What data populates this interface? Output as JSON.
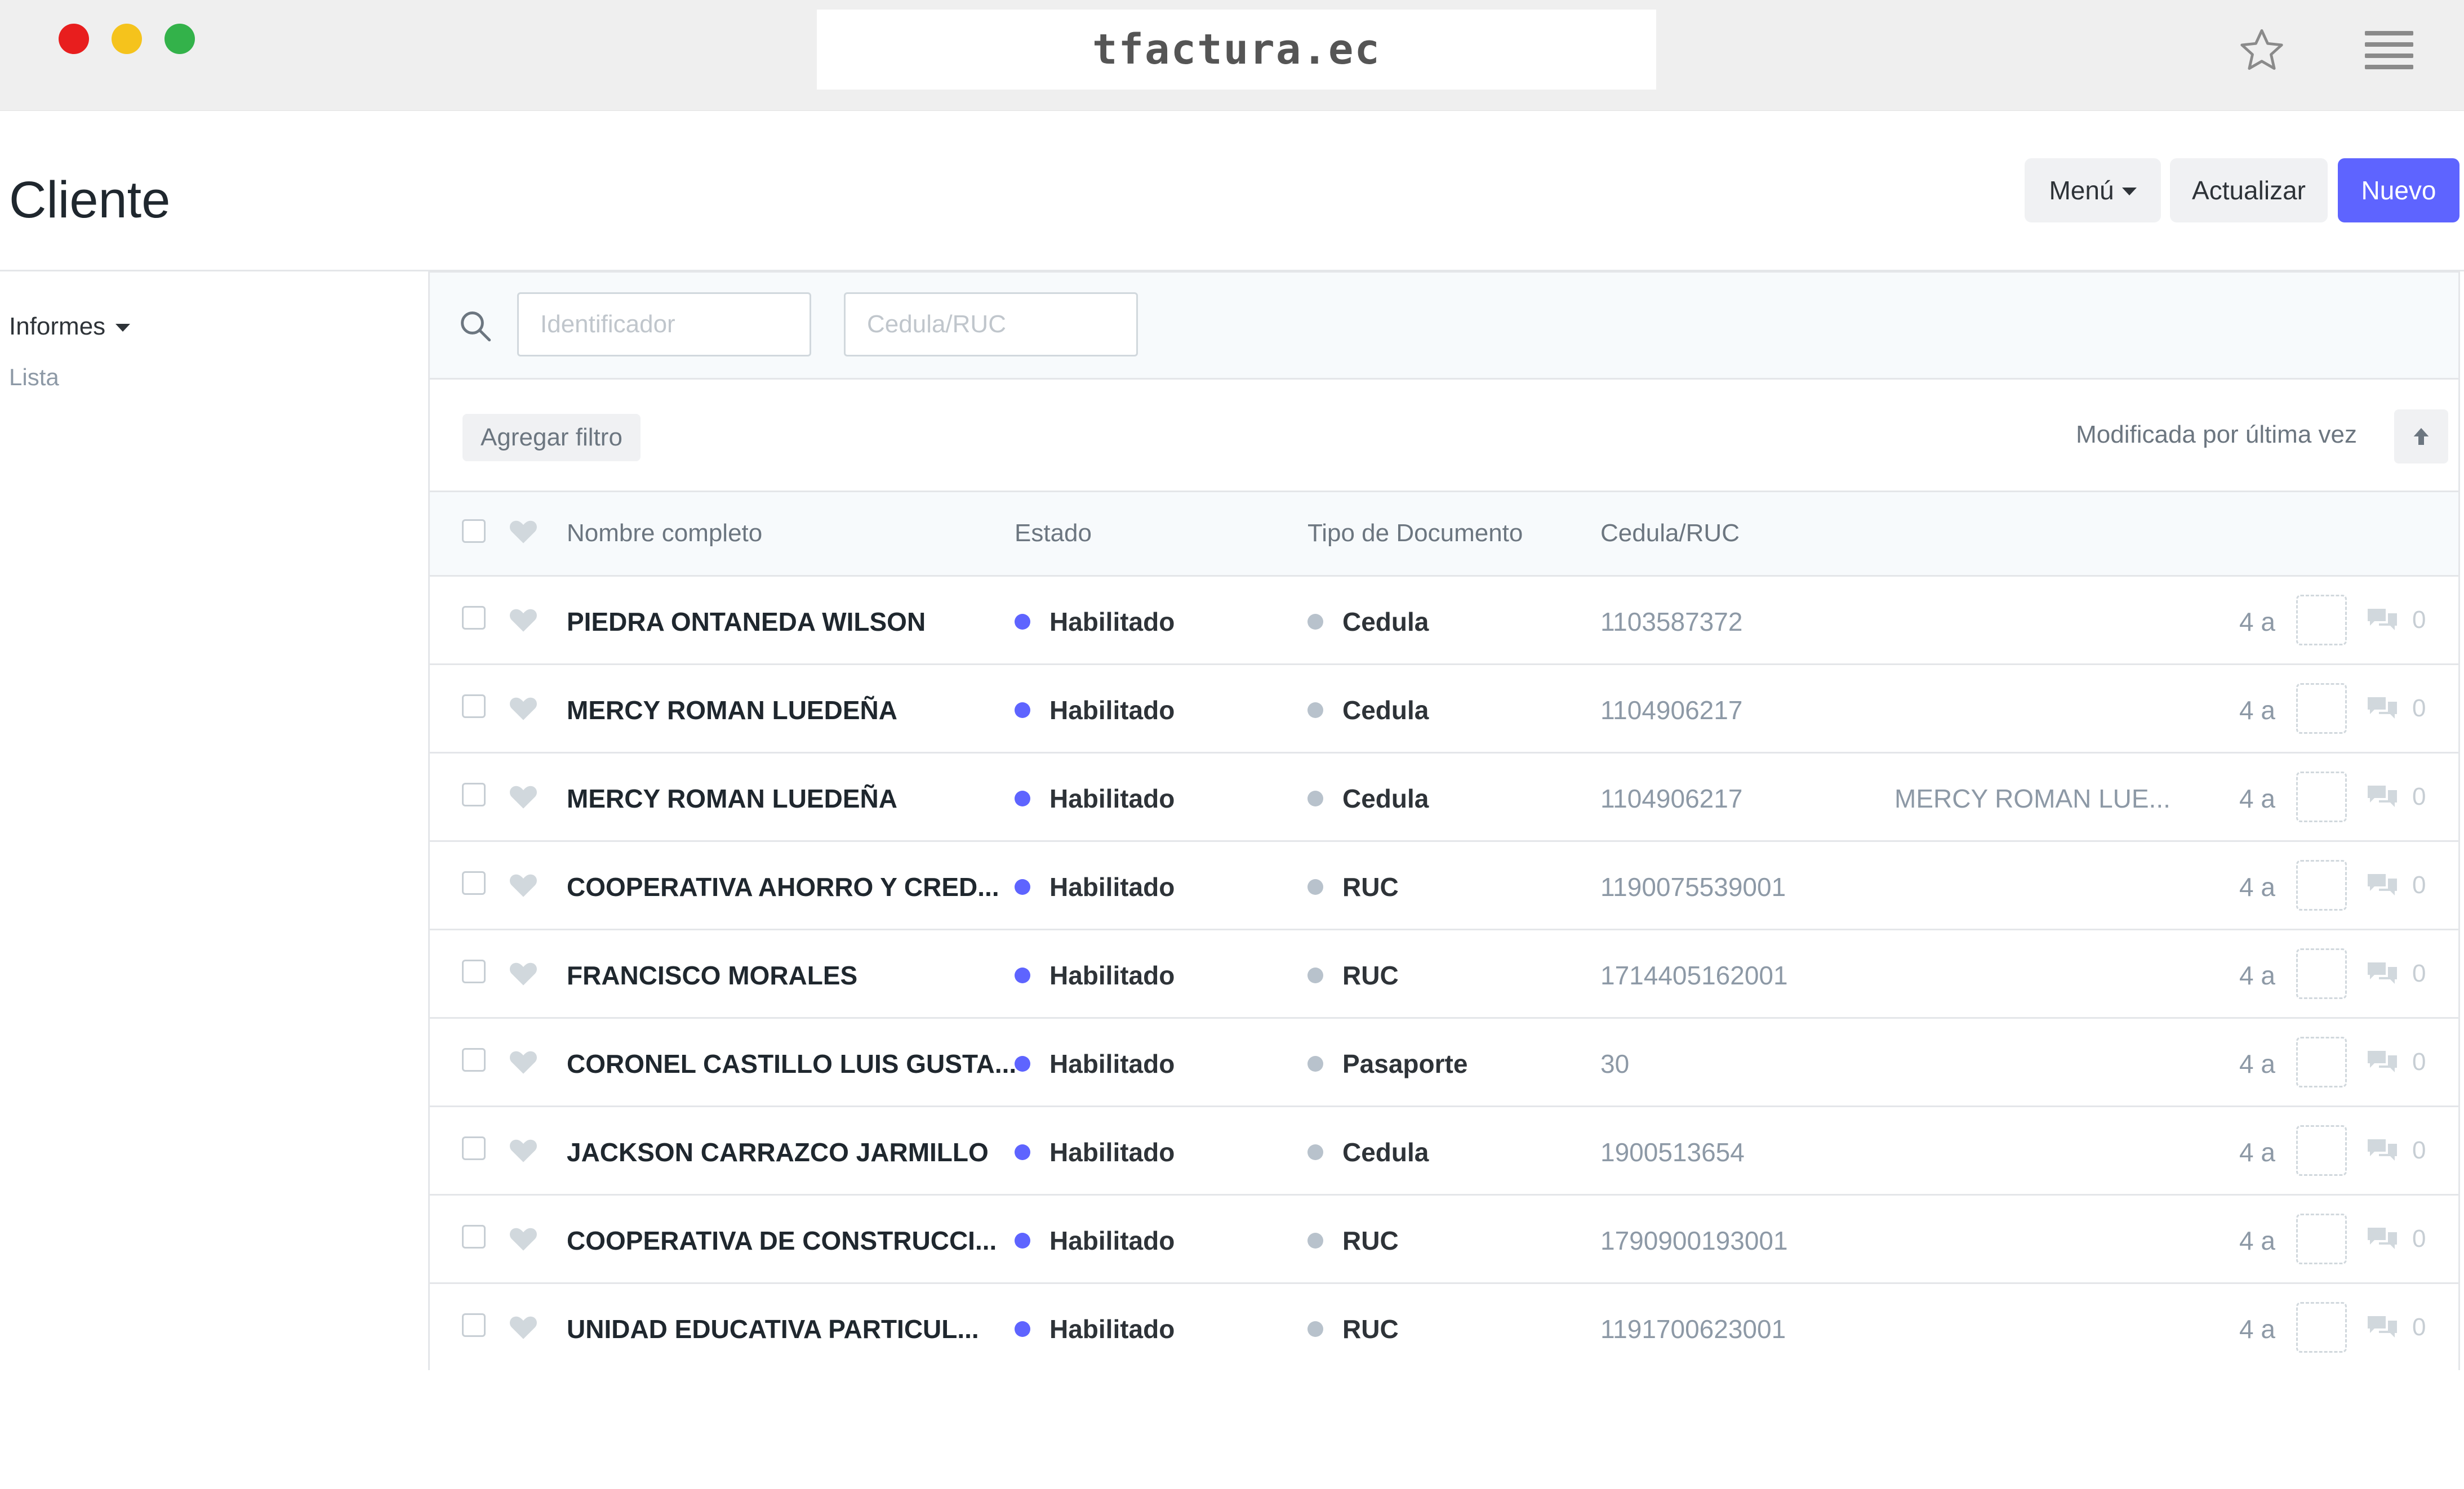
{
  "browser": {
    "url": "tfactura.ec",
    "traffic_lights": [
      "#e81e1e",
      "#f5c31c",
      "#33b24a"
    ]
  },
  "header": {
    "title": "Cliente",
    "menu_label": "Menú",
    "refresh_label": "Actualizar",
    "new_label": "Nuevo",
    "primary_color": "#5e64ff"
  },
  "sidebar": {
    "reports_label": "Informes",
    "list_label": "Lista"
  },
  "filters": {
    "identifier_placeholder": "Identificador",
    "ruc_placeholder": "Cedula/RUC",
    "add_filter_label": "Agregar filtro",
    "sort_label": "Modificada por última vez"
  },
  "table": {
    "columns": [
      "Nombre completo",
      "Estado",
      "Tipo de Documento",
      "Cedula/RUC"
    ],
    "status_color": "#5e64ff",
    "type_color": "#b8c2cc",
    "rows": [
      {
        "name": "PIEDRA ONTANEDA WILSON",
        "status": "Habilitado",
        "doc_type": "Cedula",
        "ruc": "1103587372",
        "extra": "",
        "age": "4 a",
        "comments": "0"
      },
      {
        "name": "MERCY ROMAN LUEDEÑA",
        "status": "Habilitado",
        "doc_type": "Cedula",
        "ruc": "1104906217",
        "extra": "",
        "age": "4 a",
        "comments": "0"
      },
      {
        "name": "MERCY ROMAN LUEDEÑA",
        "status": "Habilitado",
        "doc_type": "Cedula",
        "ruc": "1104906217",
        "extra": "MERCY ROMAN LUE...",
        "age": "4 a",
        "comments": "0"
      },
      {
        "name": "COOPERATIVA AHORRO Y CRED...",
        "status": "Habilitado",
        "doc_type": "RUC",
        "ruc": "1190075539001",
        "extra": "",
        "age": "4 a",
        "comments": "0"
      },
      {
        "name": "FRANCISCO MORALES",
        "status": "Habilitado",
        "doc_type": "RUC",
        "ruc": "1714405162001",
        "extra": "",
        "age": "4 a",
        "comments": "0"
      },
      {
        "name": "CORONEL CASTILLO LUIS GUSTA...",
        "status": "Habilitado",
        "doc_type": "Pasaporte",
        "ruc": "30",
        "extra": "",
        "age": "4 a",
        "comments": "0"
      },
      {
        "name": "JACKSON CARRAZCO JARMILLO",
        "status": "Habilitado",
        "doc_type": "Cedula",
        "ruc": "1900513654",
        "extra": "",
        "age": "4 a",
        "comments": "0"
      },
      {
        "name": "COOPERATIVA DE CONSTRUCCI...",
        "status": "Habilitado",
        "doc_type": "RUC",
        "ruc": "1790900193001",
        "extra": "",
        "age": "4 a",
        "comments": "0"
      },
      {
        "name": "UNIDAD EDUCATIVA PARTICUL...",
        "status": "Habilitado",
        "doc_type": "RUC",
        "ruc": "1191700623001",
        "extra": "",
        "age": "4 a",
        "comments": "0"
      }
    ]
  }
}
